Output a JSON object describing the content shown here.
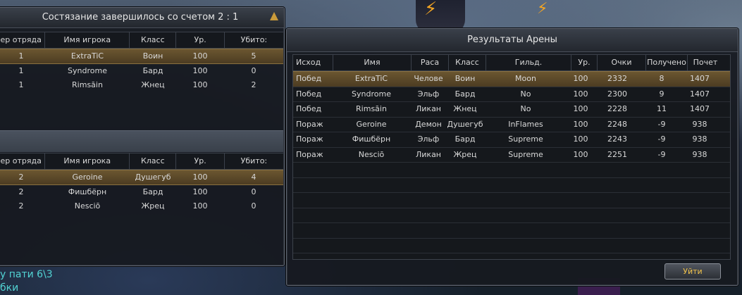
{
  "score_window": {
    "title": "Состязание завершилось со счетом 2 : 1",
    "headers": [
      "ер отряда",
      "Имя игрока",
      "Класс",
      "Ур.",
      "Убито:"
    ],
    "team1": [
      {
        "team": "1",
        "name": "ExtraTiC",
        "cls": "Воин",
        "lvl": "100",
        "kills": "5"
      },
      {
        "team": "1",
        "name": "Syndrome",
        "cls": "Бард",
        "lvl": "100",
        "kills": "0"
      },
      {
        "team": "1",
        "name": "Rimsāin",
        "cls": "Жнец",
        "lvl": "100",
        "kills": "2"
      }
    ],
    "team2": [
      {
        "team": "2",
        "name": "Geroine",
        "cls": "Душегуб",
        "lvl": "100",
        "kills": "4"
      },
      {
        "team": "2",
        "name": "Фишбёрн",
        "cls": "Бард",
        "lvl": "100",
        "kills": "0"
      },
      {
        "team": "2",
        "name": "Nesciō",
        "cls": "Жрец",
        "lvl": "100",
        "kills": "0"
      }
    ]
  },
  "arena_window": {
    "title": "Результаты Арены",
    "headers": [
      "Исход",
      "Имя",
      "Раса",
      "Класс",
      "Гильд.",
      "Ур.",
      "Очки",
      "Получено",
      "Почет"
    ],
    "rows": [
      {
        "res": "Побед",
        "name": "ExtraTiC",
        "race": "Челове",
        "cls": "Воин",
        "guild": "Moon",
        "lvl": "100",
        "pts": "2332",
        "recv": "8",
        "hon": "1407"
      },
      {
        "res": "Побед",
        "name": "Syndrome",
        "race": "Эльф",
        "cls": "Бард",
        "guild": "No",
        "lvl": "100",
        "pts": "2300",
        "recv": "9",
        "hon": "1407"
      },
      {
        "res": "Побед",
        "name": "Rimsāin",
        "race": "Ликан",
        "cls": "Жнец",
        "guild": "No",
        "lvl": "100",
        "pts": "2228",
        "recv": "11",
        "hon": "1407"
      },
      {
        "res": "Пораж",
        "name": "Geroine",
        "race": "Демон",
        "cls": "Душегуб",
        "guild": "InFlames",
        "lvl": "100",
        "pts": "2248",
        "recv": "-9",
        "hon": "938"
      },
      {
        "res": "Пораж",
        "name": "Фишбёрн",
        "race": "Эльф",
        "cls": "Бард",
        "guild": "Supreme",
        "lvl": "100",
        "pts": "2243",
        "recv": "-9",
        "hon": "938"
      },
      {
        "res": "Пораж",
        "name": "Nesciō",
        "race": "Ликан",
        "cls": "Жрец",
        "guild": "Supreme",
        "lvl": "100",
        "pts": "2251",
        "recv": "-9",
        "hon": "938"
      }
    ],
    "leave_label": "Уйти"
  },
  "chat": {
    "line1": "у пати 6\\3",
    "line2": "бки"
  },
  "colors": {
    "accent": "#f0c24a",
    "selected_row": "#6b5630",
    "chat": "#52d3d3"
  }
}
